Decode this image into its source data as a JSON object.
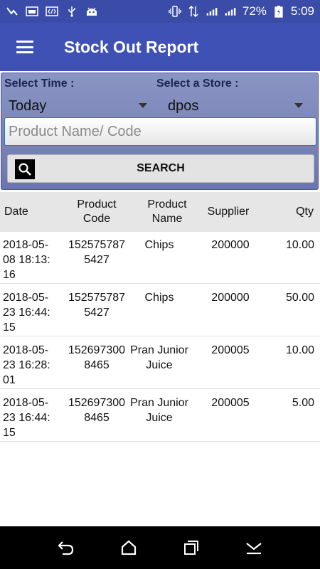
{
  "status_bar": {
    "battery": "72%",
    "time": "5:09",
    "icons": [
      "notification-check-icon",
      "image-icon",
      "code-icon",
      "usb-icon",
      "android-icon",
      "vibrate-icon",
      "data-transfer-icon",
      "signal-1-icon",
      "signal-2-icon",
      "battery-charging-icon"
    ]
  },
  "app_bar": {
    "title": "Stock Out Report",
    "menu_icon": "hamburger-menu-icon",
    "color": "#3f51b5"
  },
  "filters": {
    "time_label": "Select Time :",
    "time_value": "Today",
    "store_label": "Select a Store :",
    "store_value": "dpos",
    "search_placeholder": "Product Name/ Code",
    "search_button": "SEARCH"
  },
  "table": {
    "headers": {
      "date": "Date",
      "code": "Product Code",
      "name": "Product Name",
      "supplier": "Supplier",
      "qty": "Qty"
    },
    "rows": [
      {
        "date": "2018-05-08 18:13:16",
        "code": "1525757875427",
        "name": "Chips",
        "supplier": "200000",
        "qty": "10.00"
      },
      {
        "date": "2018-05-23 16:44:15",
        "code": "1525757875427",
        "name": "Chips",
        "supplier": "200000",
        "qty": "50.00"
      },
      {
        "date": "2018-05-23 16:28:01",
        "code": "1526973008465",
        "name": "Pran Junior Juice",
        "supplier": "200005",
        "qty": "10.00"
      },
      {
        "date": "2018-05-23 16:44:15",
        "code": "1526973008465",
        "name": "Pran Junior Juice",
        "supplier": "200005",
        "qty": "5.00"
      }
    ]
  },
  "nav_bar": {
    "icons": [
      "back-icon",
      "home-icon",
      "recents-icon",
      "menu-down-icon"
    ]
  }
}
